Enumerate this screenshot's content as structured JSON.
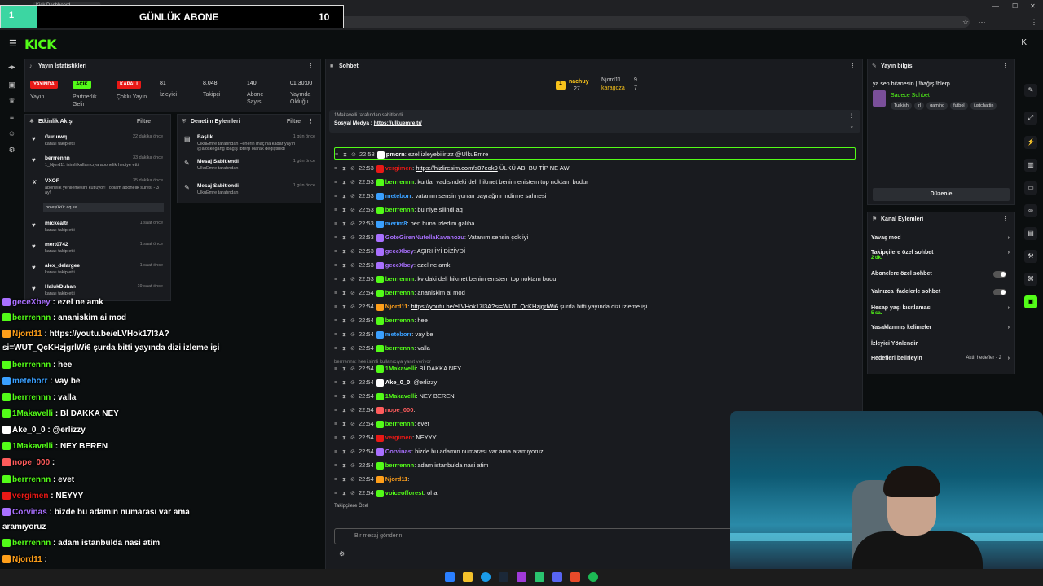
{
  "browser": {
    "tab_title": "Kick Dashboard",
    "url": "https://dashboard.kick.com/stream"
  },
  "overlay_banner": {
    "left_num": "1",
    "label": "GÜNLÜK ABONE",
    "count": "10"
  },
  "header": {
    "logo": "KICK"
  },
  "stats": {
    "title": "Yayın İstatistikleri",
    "items": [
      {
        "badge": "YAYINDA",
        "badge_color": "#e91916",
        "label": "Yayın"
      },
      {
        "badge": "AÇIK",
        "badge_color": "#53fc18",
        "label": "Partnerlik Gelir"
      },
      {
        "badge": "KAPALI",
        "badge_color": "#e91916",
        "label": "Çoklu Yayın"
      },
      {
        "value": "81",
        "label": "İzleyici"
      },
      {
        "value": "8.048",
        "label": "Takipçi"
      },
      {
        "value": "140",
        "label": "Abone Sayısı"
      },
      {
        "value": "01:30:00",
        "label": "Yayında Olduğu"
      }
    ]
  },
  "activity": {
    "title": "Etkinlik Akışı",
    "filter": "Filtre",
    "items": [
      {
        "name": "Gururwq",
        "time": "22 dakika önce",
        "sub": "kanalı takip etti"
      },
      {
        "name": "berrrennn",
        "time": "33 dakika önce",
        "sub": "1_Njord11 isimli kullanıcıya abonelik hediye etti."
      },
      {
        "name": "VXOF",
        "time": "35 dakika önce",
        "sub": "abonelik yenilemesini kutluyor! Toplam abonelik süresi - 3 ay!"
      },
      {
        "name": "mickealtr",
        "time": "1 saat önce",
        "sub": "kanalı takip etti"
      },
      {
        "name": "mert0742",
        "time": "1 saat önce",
        "sub": "kanalı takip etti"
      },
      {
        "name": "alex_delargee",
        "time": "1 saat önce",
        "sub": "kanalı takip etti"
      },
      {
        "name": "HalukDuhan",
        "time": "19 saat önce",
        "sub": "kanalı takip etti"
      }
    ],
    "vxof_note": "holeşükür aq sa"
  },
  "mod": {
    "title": "Denetim Eylemleri",
    "filter": "Filtre",
    "items": [
      {
        "title": "Başlık",
        "time": "1 gün önce",
        "desc": "UlkuEmre tarafından Fenerin maçına kadar yayın | @aloskegang ibağış ibterp olarak değiştirildi"
      },
      {
        "title": "Mesaj Sabitlendi",
        "time": "1 gün önce",
        "desc": "UlkuEmre tarafından"
      },
      {
        "title": "Mesaj Sabitlendi",
        "time": "1 gün önce",
        "desc": "UlkuEmre tarafından"
      }
    ]
  },
  "chat": {
    "title": "Sohbet",
    "top": [
      {
        "name": "nachuy",
        "num": "27"
      },
      {
        "name": "Njord11",
        "num": "9"
      },
      {
        "name": "karagoza",
        "num": "7"
      }
    ],
    "pinned_by": "1Makavelli tarafından sabitlendi",
    "pinned_text": "Sosyal Medya :",
    "pinned_link": "https://ulkuemre.tr/",
    "messages": [
      {
        "time": "22:53",
        "user": "pmcrn",
        "color": "#ffffff",
        "text": "ezel izleyebilirizz @UlkuEmre"
      },
      {
        "time": "22:53",
        "user": "vergimen",
        "color": "#e91916",
        "text": "",
        "link": "https://hizliresim.com/s87eok9",
        "after": " ÜLKÜ ABİ BU TİP NE AW"
      },
      {
        "time": "22:53",
        "user": "berrrennn",
        "color": "#53fc18",
        "text": "kurtlar vadisindeki deli hikmet benim enistem top noktam budur"
      },
      {
        "time": "22:53",
        "user": "meteborr",
        "color": "#3aa0ff",
        "text": "vatanım sensin yunan bayrağını indirme sahnesi"
      },
      {
        "time": "22:53",
        "user": "berrrennn",
        "color": "#53fc18",
        "text": "bu niye silindi aq"
      },
      {
        "time": "22:53",
        "user": "merim8",
        "color": "#3aa0ff",
        "text": "ben buna izledim galiba"
      },
      {
        "time": "22:53",
        "user": "GoteGirenNutellaKavanozu",
        "color": "#a970ff",
        "text": "Vatanım sensin çok iyi"
      },
      {
        "time": "22:53",
        "user": "geceXbey",
        "color": "#a970ff",
        "text": "AŞIRI İYİ DİZİYDİ"
      },
      {
        "time": "22:53",
        "user": "geceXbey",
        "color": "#a970ff",
        "text": "ezel ne amk"
      },
      {
        "time": "22:53",
        "user": "berrrennn",
        "color": "#53fc18",
        "text": "kv daki deli hikmet benim enistem top noktam budur"
      },
      {
        "time": "22:54",
        "user": "berrrennn",
        "color": "#53fc18",
        "text": "ananiskim ai mod"
      },
      {
        "time": "22:54",
        "user": "Njord11",
        "color": "#ff9f1a",
        "text": "",
        "link": "https://youtu.be/eLVHok17l3A?si=WUT_QcKHzjgrlWi6",
        "after": " şurda bitti yayında dizi izleme işi"
      },
      {
        "time": "22:54",
        "user": "berrrennn",
        "color": "#53fc18",
        "text": "hee"
      },
      {
        "time": "22:54",
        "user": "meteborr",
        "color": "#3aa0ff",
        "text": "vay be"
      },
      {
        "time": "22:54",
        "user": "berrrennn",
        "color": "#53fc18",
        "text": "valla"
      },
      {
        "time": "22:54",
        "user": "1Makavelli",
        "color": "#53fc18",
        "text": "Bİ DAKKA NEY"
      },
      {
        "time": "22:54",
        "user": "Ake_0_0",
        "color": "#ffffff",
        "text": "@erlizzy"
      },
      {
        "time": "22:54",
        "user": "1Makavelli",
        "color": "#53fc18",
        "text": "NEY BEREN"
      },
      {
        "time": "22:54",
        "user": "nope_000",
        "color": "#ff5c5c",
        "text": ""
      },
      {
        "time": "22:54",
        "user": "berrrennn",
        "color": "#53fc18",
        "text": "evet"
      },
      {
        "time": "22:54",
        "user": "vergimen",
        "color": "#e91916",
        "text": "NEYYY"
      },
      {
        "time": "22:54",
        "user": "Corvinas",
        "color": "#a970ff",
        "text": "bizde bu adamın numarası var ama aramıyoruz"
      },
      {
        "time": "22:54",
        "user": "berrrennn",
        "color": "#53fc18",
        "text": "adam istanbulda nasi atim"
      },
      {
        "time": "22:54",
        "user": "Njord11",
        "color": "#ff9f1a",
        "text": ""
      },
      {
        "time": "22:54",
        "user": "voiceofforest",
        "color": "#53fc18",
        "text": "oha"
      }
    ],
    "deleted_note": "berrrennn: hee isimli kullanıcıya yanıt veriyor",
    "followers_label": "Takipçilere Özel",
    "input_placeholder": "Bir mesaj gönderin"
  },
  "stream_info": {
    "title": "Yayın bilgisi",
    "stream_title": "ya sen bitanesin | !bağış !blerp",
    "category": "Sadece Sohbet",
    "tags": [
      "Turkish",
      "irl",
      "gaming",
      "futbol",
      "justchattin"
    ],
    "edit": "Düzenle"
  },
  "channel_actions": {
    "title": "Kanal Eylemleri",
    "rows": [
      {
        "label": "Yavaş mod",
        "sub": "",
        "control": "arrow"
      },
      {
        "label": "Takipçilere özel sohbet",
        "sub": "2 dk.",
        "control": "arrow"
      },
      {
        "label": "Abonelere özel sohbet",
        "sub": "",
        "control": "toggle"
      },
      {
        "label": "Yalnızca ifadelerle sohbet",
        "sub": "",
        "control": "toggle"
      },
      {
        "label": "Hesap yaşı kısıtlaması",
        "sub": "5 sa.",
        "control": "arrow"
      },
      {
        "label": "Yasaklanmış kelimeler",
        "sub": "",
        "control": "arrow"
      },
      {
        "label": "İzleyici Yönlendir",
        "sub": "",
        "control": "none"
      },
      {
        "label": "Hedefleri belirleyin",
        "sub": "",
        "control": "arrow",
        "extra": "Aktif hedefler - 2"
      }
    ]
  },
  "overlay_chat": [
    {
      "user": "geceXbey",
      "text": "ezel ne amk",
      "color": "#a970ff"
    },
    {
      "user": "berrrennn",
      "text": "ananiskim ai mod",
      "color": "#53fc18"
    },
    {
      "user": "Njord11",
      "text": "https://youtu.be/eLVHok17l3A?",
      "color": "#ff9f1a"
    },
    {
      "user": "",
      "text": "si=WUT_QcKHzjgrlWi6 şurda bitti yayında dizi izleme işi",
      "color": "#ffffff"
    },
    {
      "user": "berrrennn",
      "text": "hee",
      "color": "#53fc18"
    },
    {
      "user": "meteborr",
      "text": "vay be",
      "color": "#3aa0ff"
    },
    {
      "user": "berrrennn",
      "text": "valla",
      "color": "#53fc18"
    },
    {
      "user": "1Makavelli",
      "text": "Bİ DAKKA NEY",
      "color": "#53fc18"
    },
    {
      "user": "Ake_0_0",
      "text": "@erlizzy",
      "color": "#ffffff"
    },
    {
      "user": "1Makavelli",
      "text": "NEY BEREN",
      "color": "#53fc18"
    },
    {
      "user": "nope_000",
      "text": "",
      "color": "#ff5c5c"
    },
    {
      "user": "berrrennn",
      "text": "evet",
      "color": "#53fc18"
    },
    {
      "user": "vergimen",
      "text": "NEYYY",
      "color": "#e91916"
    },
    {
      "user": "Corvinas",
      "text": "bizde bu adamın numarası var ama",
      "color": "#a970ff"
    },
    {
      "user": "",
      "text": "aramıyoruz",
      "color": "#ffffff"
    },
    {
      "user": "berrrennn",
      "text": "adam istanbulda nasi atim",
      "color": "#53fc18"
    },
    {
      "user": "Njord11",
      "text": "",
      "color": "#ff9f1a"
    },
    {
      "user": "voiceofforest",
      "text": "oha",
      "color": "#53fc18"
    }
  ]
}
